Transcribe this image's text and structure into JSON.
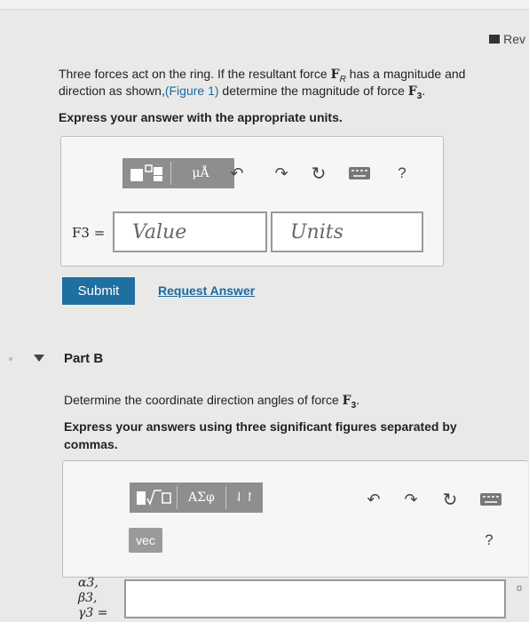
{
  "header": {
    "rev_label": "Rev"
  },
  "question": {
    "line1_pre": "Three forces act on the ring. If the resultant force ",
    "fr_symbol": "F",
    "fr_sub": "R",
    "line1_post": " has a magnitude and",
    "line2_pre": "direction as shown,",
    "figure_link": "(Figure 1)",
    "line2_mid": " determine the magnitude of force ",
    "f3_symbol": "F",
    "f3_sub": "3",
    "line2_end": ".",
    "instruction": "Express your answer with the appropriate units."
  },
  "partA": {
    "toolbar": {
      "mu_label": "μÅ",
      "help_label": "?"
    },
    "answer_label": "F3 =",
    "value_placeholder": "Value",
    "units_placeholder": "Units",
    "submit_label": "Submit",
    "request_label": "Request Answer"
  },
  "partB": {
    "title": "Part B",
    "question_pre": "Determine the coordinate direction angles of force ",
    "f3_symbol": "F",
    "f3_sub": "3",
    "question_end": ".",
    "instruction_line1": "Express your answers using three significant figures separated by",
    "instruction_line2": "commas.",
    "toolbar": {
      "greek_label": "ΑΣφ",
      "arrows_label": "⇃↾",
      "vec_label": "vec",
      "help_label": "?"
    },
    "labels": {
      "alpha": "α3,",
      "beta": "β3,",
      "gamma": "γ3 ="
    },
    "side_mark": "o"
  },
  "colors": {
    "link": "#1a6aa3",
    "submit": "#1f6fa0",
    "toolbar": "#8e8e8c"
  },
  "icons": [
    "templates-icon",
    "undo-icon",
    "redo-icon",
    "reset-icon",
    "keyboard-icon",
    "help-icon",
    "sqrt-icon"
  ]
}
